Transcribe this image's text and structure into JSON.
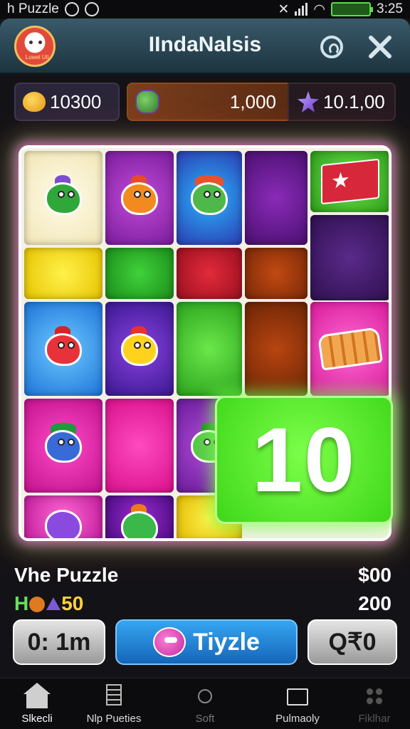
{
  "status_bar": {
    "app_name": "h Puzzle",
    "time": "3:25"
  },
  "header": {
    "title": "IIndaNalsis",
    "avatar_caption": "Luwel Uli"
  },
  "resources": {
    "coins": "10300",
    "middle": "1,000",
    "gems": "10.1,00"
  },
  "board": {
    "highlight_number": "10"
  },
  "info": {
    "title": "Vhe Puzzle",
    "price": "$00",
    "bonus_prefix": "H",
    "bonus_value": "50",
    "count": "200"
  },
  "actions": {
    "timer": "0: 1m",
    "play": "Tiyzle",
    "right": "Q₹0"
  },
  "nav": [
    {
      "label": "Slkecli",
      "icon": "home-icon"
    },
    {
      "label": "Nlp Pueties",
      "icon": "document-icon"
    },
    {
      "label": "Soft",
      "icon": "sun-icon"
    },
    {
      "label": "Pulmaoly",
      "icon": "folder-icon"
    },
    {
      "label": "Fiklhar",
      "icon": "grid-icon"
    }
  ],
  "colors": {
    "accent_green": "#3ed71a",
    "play_blue": "#1e7fd6",
    "coin_yellow": "#ffd23a"
  }
}
